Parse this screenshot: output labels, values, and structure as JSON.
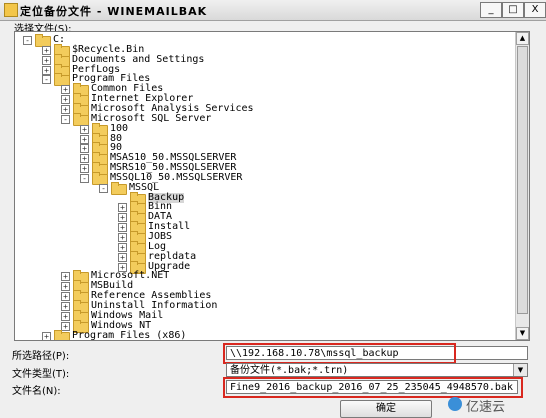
{
  "window": {
    "title": "定位备份文件 - WINEMAILBAK",
    "minimize": "_",
    "maximize": "□",
    "close": "X"
  },
  "select_file_label": "选择文件(S):",
  "tree": [
    {
      "label": "C:",
      "depth": 0,
      "expander": "-"
    },
    {
      "label": "$Recycle.Bin",
      "depth": 1,
      "expander": "+"
    },
    {
      "label": "Documents and Settings",
      "depth": 1,
      "expander": "+"
    },
    {
      "label": "PerfLogs",
      "depth": 1,
      "expander": "+"
    },
    {
      "label": "Program Files",
      "depth": 1,
      "expander": "-"
    },
    {
      "label": "Common Files",
      "depth": 2,
      "expander": "+"
    },
    {
      "label": "Internet Explorer",
      "depth": 2,
      "expander": "+"
    },
    {
      "label": "Microsoft Analysis Services",
      "depth": 2,
      "expander": "+"
    },
    {
      "label": "Microsoft SQL Server",
      "depth": 2,
      "expander": "-"
    },
    {
      "label": "100",
      "depth": 3,
      "expander": "+"
    },
    {
      "label": "80",
      "depth": 3,
      "expander": "+"
    },
    {
      "label": "90",
      "depth": 3,
      "expander": "+"
    },
    {
      "label": "MSAS10_50.MSSQLSERVER",
      "depth": 3,
      "expander": "+"
    },
    {
      "label": "MSRS10_50.MSSQLSERVER",
      "depth": 3,
      "expander": "+"
    },
    {
      "label": "MSSQL10_50.MSSQLSERVER",
      "depth": 3,
      "expander": "-"
    },
    {
      "label": "MSSQL",
      "depth": 4,
      "expander": "-"
    },
    {
      "label": "Backup",
      "depth": 5,
      "expander": "",
      "selected": true
    },
    {
      "label": "Binn",
      "depth": 5,
      "expander": "+"
    },
    {
      "label": "DATA",
      "depth": 5,
      "expander": "+"
    },
    {
      "label": "Install",
      "depth": 5,
      "expander": "+"
    },
    {
      "label": "JOBS",
      "depth": 5,
      "expander": "+"
    },
    {
      "label": "Log",
      "depth": 5,
      "expander": "+"
    },
    {
      "label": "repldata",
      "depth": 5,
      "expander": "+"
    },
    {
      "label": "Upgrade",
      "depth": 5,
      "expander": "+"
    },
    {
      "label": "Microsoft.NET",
      "depth": 2,
      "expander": "+"
    },
    {
      "label": "MSBuild",
      "depth": 2,
      "expander": "+"
    },
    {
      "label": "Reference Assemblies",
      "depth": 2,
      "expander": "+"
    },
    {
      "label": "Uninstall Information",
      "depth": 2,
      "expander": "+"
    },
    {
      "label": "Windows Mail",
      "depth": 2,
      "expander": "+"
    },
    {
      "label": "Windows NT",
      "depth": 2,
      "expander": "+"
    },
    {
      "label": "Program Files (x86)",
      "depth": 1,
      "expander": "+"
    }
  ],
  "path": {
    "label": "所选路径(P):",
    "value": "\\\\192.168.10.78\\mssql_backup"
  },
  "file_type": {
    "label": "文件类型(T):",
    "value": "备份文件(*.bak;*.trn)"
  },
  "file_name": {
    "label": "文件名(N):",
    "value": "Fine9_2016_backup_2016_07_25_235045_4948570.bak"
  },
  "ok_button": "确定",
  "watermark": "亿速云",
  "colors": {
    "highlight_border": "#d9281f",
    "folder": "#f3cc5c"
  },
  "scrollbar_up": "▲",
  "scrollbar_down": "▼",
  "combo_arrow": "▼"
}
